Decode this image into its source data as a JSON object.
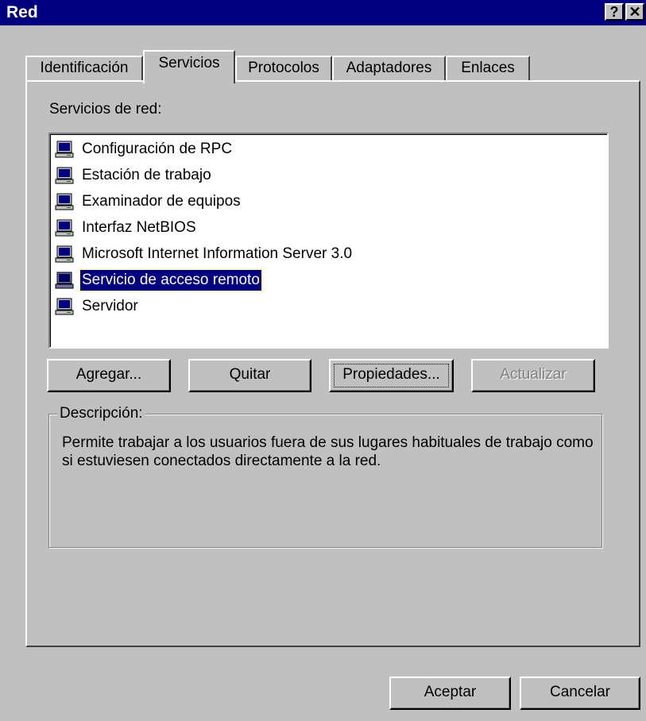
{
  "window": {
    "title": "Red",
    "help_label": "?",
    "close_label": "✕"
  },
  "tabs": [
    {
      "label": "Identificación"
    },
    {
      "label": "Servicios"
    },
    {
      "label": "Protocolos"
    },
    {
      "label": "Adaptadores"
    },
    {
      "label": "Enlaces"
    }
  ],
  "active_tab": "Servicios",
  "services_label": "Servicios de red:",
  "services": [
    {
      "label": "Configuración de RPC",
      "icon": "computer-icon"
    },
    {
      "label": "Estación de trabajo",
      "icon": "computer-icon"
    },
    {
      "label": "Examinador de equipos",
      "icon": "computer-icon"
    },
    {
      "label": "Interfaz NetBIOS",
      "icon": "computer-icon"
    },
    {
      "label": "Microsoft Internet Information Server 3.0",
      "icon": "computer-icon"
    },
    {
      "label": "Servicio de acceso remoto",
      "icon": "computer-icon"
    },
    {
      "label": "Servidor",
      "icon": "computer-icon"
    }
  ],
  "selected_service": "Servicio de acceso remoto",
  "buttons": {
    "add": "Agregar...",
    "remove": "Quitar",
    "properties": "Propiedades...",
    "update": "Actualizar"
  },
  "description": {
    "legend": "Descripción:",
    "text": "Permite trabajar a los usuarios fuera de sus lugares habituales de trabajo como si estuviesen conectados directamente a la red."
  },
  "footer": {
    "ok": "Aceptar",
    "cancel": "Cancelar"
  },
  "colors": {
    "face": "#c0c0c0",
    "titlebar": "#000080",
    "selection": "#000080"
  }
}
